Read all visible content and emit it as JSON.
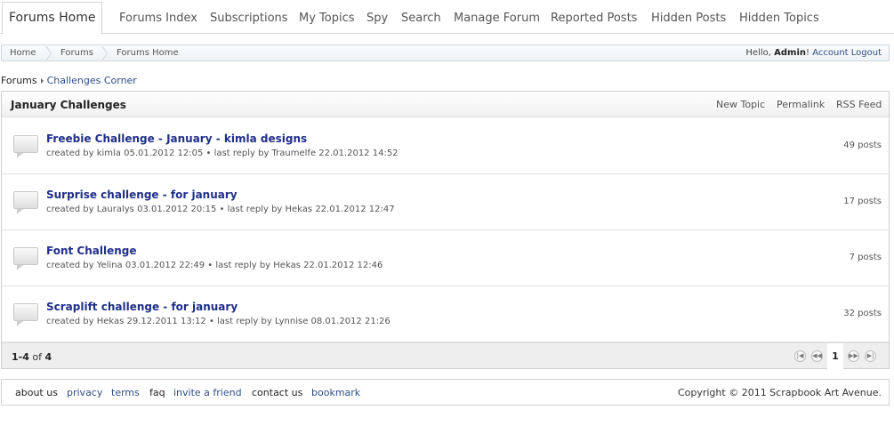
{
  "tabs": [
    {
      "label": "Forums Home",
      "active": true
    },
    {
      "label": "Forums Index"
    },
    {
      "label": "Subscriptions"
    },
    {
      "label": "My Topics"
    },
    {
      "label": "Spy"
    },
    {
      "label": "Search"
    },
    {
      "label": "Manage Forum"
    },
    {
      "label": "Reported Posts"
    },
    {
      "label": "Hidden Posts"
    },
    {
      "label": "Hidden Topics"
    }
  ],
  "breadcrumb": [
    "Home",
    "Forums",
    "Forums Home"
  ],
  "user": {
    "greeting": "Hello,",
    "name": "Admin",
    "excl": "!",
    "logout": "Account Logout"
  },
  "path": {
    "root": "Forums",
    "current": "Challenges Corner"
  },
  "forum": {
    "title": "January Challenges",
    "actions": {
      "new_topic": "New Topic",
      "permalink": "Permalink",
      "rss": "RSS Feed"
    },
    "topics": [
      {
        "title": "Freebie Challenge - January - kimla designs",
        "meta": "created by kimla 05.01.2012 12:05 • last reply by Traumelfe 22.01.2012 14:52",
        "posts": "49 posts"
      },
      {
        "title": "Surprise challenge - for january",
        "meta": "created by Lauralys 03.01.2012 20:15 • last reply by Hekas 22.01.2012 12:47",
        "posts": "17 posts"
      },
      {
        "title": "Font Challenge",
        "meta": "created by Yelina 03.01.2012 22:49 • last reply by Hekas 22.01.2012 12:46",
        "posts": "7 posts"
      },
      {
        "title": "Scraplift challenge - for january",
        "meta": "created by Hekas 29.12.2011 13:12 • last reply by Lynnise 08.01.2012 21:26",
        "posts": "32 posts"
      }
    ],
    "pagination": {
      "range": "1-4",
      "of": "of",
      "total": "4",
      "current_page": "1"
    }
  },
  "footer": {
    "links": {
      "about": "about us",
      "privacy": "privacy",
      "terms": "terms",
      "faq": "faq",
      "invite": "invite a friend",
      "contact": "contact us",
      "bookmark": "bookmark"
    },
    "copyright": "Copyright © 2011 Scrapbook Art Avenue."
  },
  "icons": {
    "first": "first-page-icon",
    "prev": "prev-page-icon",
    "next": "next-page-icon",
    "last": "last-page-icon",
    "topic": "topic-bubble-icon"
  }
}
